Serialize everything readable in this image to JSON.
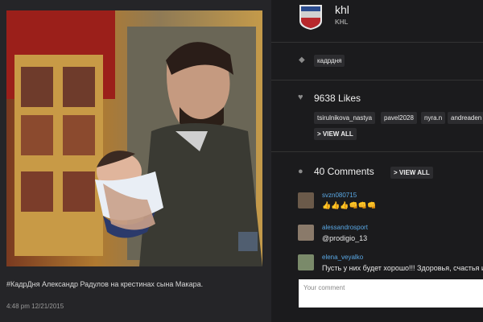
{
  "post": {
    "caption": "#КадрДня Александр Радулов на крестинах сына Макара.",
    "time": "4:48 pm 12/21/2015"
  },
  "account": {
    "name": "khl",
    "sub": "KHL"
  },
  "tags": [
    "кадрдня"
  ],
  "likes": {
    "count_label": "9638 Likes",
    "users": [
      "tsirulnikova_nastya",
      "pavel2028",
      "nyra.n",
      "andreaden"
    ],
    "view_all": "> VIEW ALL"
  },
  "comments": {
    "count_label": "40 Comments",
    "view_all": "> VIEW ALL",
    "items": [
      {
        "user": "svzn080715",
        "text": "👍👍👍👊👊👊"
      },
      {
        "user": "alessandrosport",
        "text": "@prodigio_13"
      },
      {
        "user": "elena_veyalko",
        "text": "Пусть у них будет хорошо!!! Здоровья, счастья и лю"
      }
    ],
    "input_placeholder": "Your comment"
  },
  "icons": {
    "tag": "tag-icon",
    "likes": "heart-icon",
    "comments": "speech-bubble-icon"
  }
}
